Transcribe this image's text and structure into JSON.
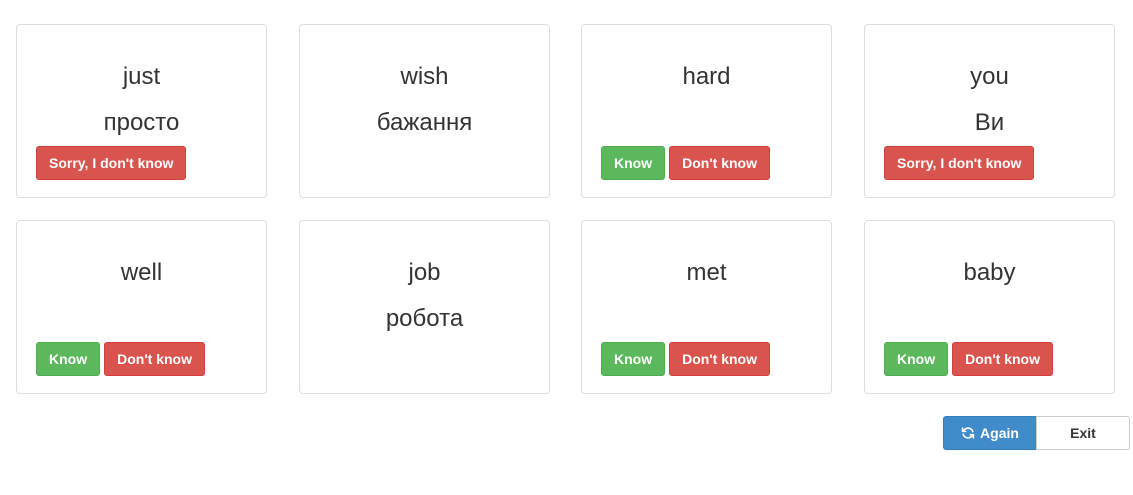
{
  "cards": [
    {
      "word": "just",
      "translation": "просто",
      "buttons": [
        {
          "label": "Sorry, I don't know",
          "style": "red"
        }
      ]
    },
    {
      "word": "wish",
      "translation": "бажання",
      "buttons": []
    },
    {
      "word": "hard",
      "translation": "",
      "buttons": [
        {
          "label": "Know",
          "style": "green"
        },
        {
          "label": "Don't know",
          "style": "red"
        }
      ]
    },
    {
      "word": "you",
      "translation": "Ви",
      "buttons": [
        {
          "label": "Sorry, I don't know",
          "style": "red"
        }
      ]
    },
    {
      "word": "well",
      "translation": "",
      "buttons": [
        {
          "label": "Know",
          "style": "green"
        },
        {
          "label": "Don't know",
          "style": "red"
        }
      ]
    },
    {
      "word": "job",
      "translation": "робота",
      "buttons": []
    },
    {
      "word": "met",
      "translation": "",
      "buttons": [
        {
          "label": "Know",
          "style": "green"
        },
        {
          "label": "Don't know",
          "style": "red"
        }
      ]
    },
    {
      "word": "baby",
      "translation": "",
      "buttons": [
        {
          "label": "Know",
          "style": "green"
        },
        {
          "label": "Don't know",
          "style": "red"
        }
      ]
    }
  ],
  "footer": {
    "again_label": "Again",
    "exit_label": "Exit",
    "again_icon": "refresh-icon"
  },
  "colors": {
    "know": "#5cb85c",
    "dont_know": "#d9534f",
    "again": "#428bca"
  }
}
